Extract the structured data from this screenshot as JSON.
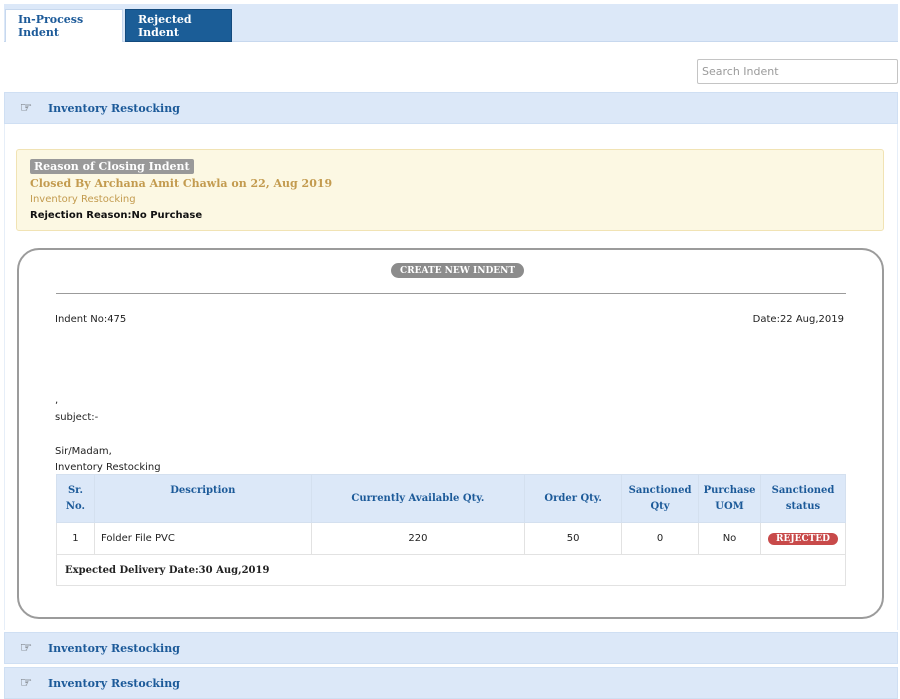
{
  "tabs": [
    {
      "label": "In-Process Indent",
      "active": false
    },
    {
      "label": "Rejected Indent",
      "active": true
    }
  ],
  "search": {
    "placeholder": "Search Indent"
  },
  "accordion": {
    "icon": "pointing-hand-icon",
    "items": [
      {
        "title": "Inventory Restocking",
        "expanded": true
      },
      {
        "title": "Inventory Restocking",
        "expanded": false
      },
      {
        "title": "Inventory Restocking",
        "expanded": false
      }
    ]
  },
  "reason": {
    "label": "Reason of Closing Indent",
    "closed_by": "Closed By Archana Amit Chawla on 22, Aug 2019",
    "subtitle": "Inventory Restocking",
    "rejection": "Rejection Reason:No Purchase"
  },
  "indent": {
    "create_button": "CREATE NEW INDENT",
    "indent_no": "Indent No:475",
    "date": "Date:22 Aug,2019",
    "comma": ",",
    "subject": "subject:-",
    "salutation": "Sir/Madam,",
    "body": "Inventory Restocking",
    "table": {
      "headers": [
        "Sr. No.",
        "Description",
        "Currently Available Qty.",
        "Order Qty.",
        "Sanctioned Qty",
        "Purchase UOM",
        "Sanctioned status"
      ],
      "rows": [
        {
          "sr": "1",
          "description": "Folder File PVC",
          "available": "220",
          "order": "50",
          "sanctioned": "0",
          "uom": "No",
          "status": "REJECTED"
        }
      ],
      "footer": "Expected Delivery Date:30 Aug,2019"
    }
  },
  "colors": {
    "tab_active": "#1b5d97",
    "header_bg": "#dce8f8",
    "header_text": "#1c5a99",
    "status_rejected": "#c84a4a",
    "reason_bg": "#fcf8e3"
  }
}
